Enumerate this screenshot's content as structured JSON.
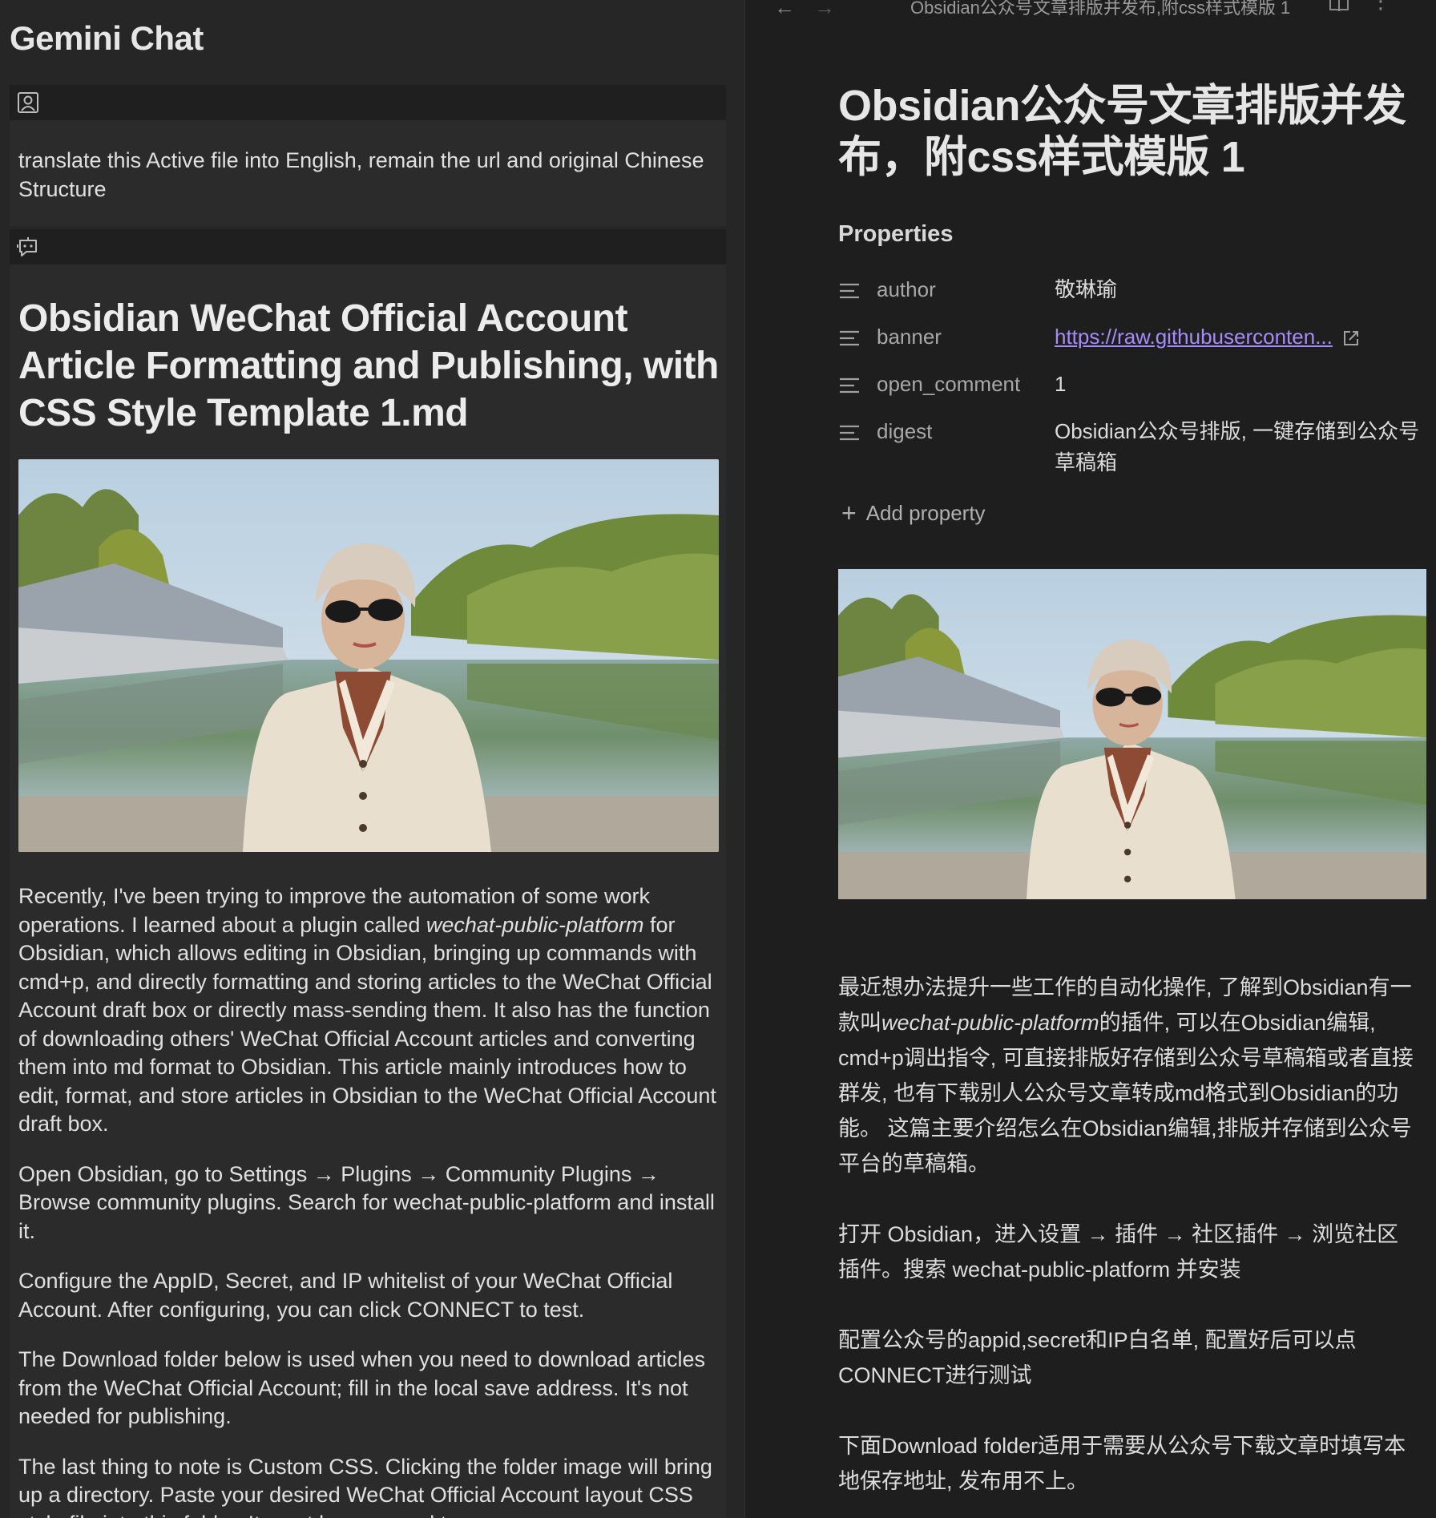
{
  "chat": {
    "title": "Gemini Chat",
    "user_message": "translate this Active file into English, remain the url and original Chinese Structure",
    "response": {
      "heading": "Obsidian WeChat Official Account Article Formatting and Publishing, with CSS Style Template 1.md",
      "p1_before": "Recently, I've been trying to improve the automation of some work operations. I learned about a plugin called ",
      "p1_em": "wechat-public-platform",
      "p1_after": " for Obsidian, which allows editing in Obsidian, bringing up commands with cmd+p, and directly formatting and storing articles to the WeChat Official Account draft box or directly mass-sending them. It also has the function of downloading others' WeChat Official Account articles and converting them into md format to Obsidian. This article mainly introduces how to edit, format, and store articles in Obsidian to the WeChat Official Account draft box.",
      "p2": "Open Obsidian, go to Settings → Plugins → Community Plugins → Browse community plugins. Search for wechat-public-platform and install it.",
      "p3": "Configure the AppID, Secret, and IP whitelist of your WeChat Official Account. After configuring, you can click CONNECT to test.",
      "p4": "The Download folder below is used when you need to download articles from the WeChat Official Account; fill in the local save address. It's not needed for publishing.",
      "p5": "The last thing to note is Custom CSS. Clicking the folder image will bring up a directory. Paste your desired WeChat Official Account layout CSS style file into this folder. It must be renamed to"
    }
  },
  "note": {
    "tab_title": "Obsidian公众号文章排版并发布,附css样式模版 1",
    "title": "Obsidian公众号文章排版并发布，附css样式模版 1",
    "properties_label": "Properties",
    "properties": [
      {
        "key": "author",
        "value": "敬琳瑜"
      },
      {
        "key": "banner",
        "value": "https://raw.githubuserconten..."
      },
      {
        "key": "open_comment",
        "value": "1"
      },
      {
        "key": "digest",
        "value": "Obsidian公众号排版, 一键存储到公众号草稿箱"
      }
    ],
    "add_property": "Add property",
    "p1_before": "最近想办法提升一些工作的自动化操作, 了解到Obsidian有一款叫",
    "p1_em": "wechat-public-platform",
    "p1_after": "的插件, 可以在Obsidian编辑, cmd+p调出指令, 可直接排版好存储到公众号草稿箱或者直接群发, 也有下载别人公众号文章转成md格式到Obsidian的功能。 这篇主要介绍怎么在Obsidian编辑,排版并存储到公众号平台的草稿箱。",
    "p2": "打开 Obsidian，进入设置 → 插件 → 社区插件 → 浏览社区插件。搜索 wechat-public-platform 并安装",
    "p3": "配置公众号的appid,secret和IP白名单, 配置好后可以点CONNECT进行测试",
    "p4": "下面Download folder适用于需要从公众号下载文章时填写本地保存地址, 发布用不上。"
  },
  "icons": {
    "user": "user-avatar-icon",
    "bot": "bot-chat-icon",
    "property": "text-property-icon",
    "external_link": "external-link-icon",
    "back": "arrow-left-icon",
    "forward": "arrow-right-icon",
    "reading_mode": "book-icon",
    "more": "more-options-icon"
  },
  "colors": {
    "link": "#a78bfa",
    "chat_bg": "#262626",
    "note_bg": "#1e1e1e"
  }
}
